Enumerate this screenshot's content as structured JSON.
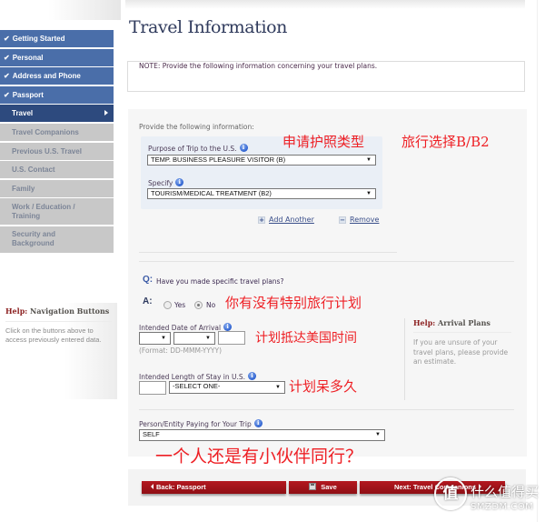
{
  "sidebar": {
    "items": [
      {
        "label": "Getting Started",
        "state": "done"
      },
      {
        "label": "Personal",
        "state": "done"
      },
      {
        "label": "Address and Phone",
        "state": "done"
      },
      {
        "label": "Passport",
        "state": "done"
      },
      {
        "label": "Travel",
        "state": "active"
      },
      {
        "label": "Travel Companions",
        "state": "pending"
      },
      {
        "label": "Previous U.S. Travel",
        "state": "pending"
      },
      {
        "label": "U.S. Contact",
        "state": "pending"
      },
      {
        "label": "Family",
        "state": "pending"
      },
      {
        "label": "Work / Education / Training",
        "state": "pending"
      },
      {
        "label": "Security and Background",
        "state": "pending"
      }
    ],
    "check_glyph": "✔",
    "help": {
      "label": "Help:",
      "title": "Navigation Buttons",
      "text": "Click on the buttons above to access previously entered data."
    }
  },
  "page": {
    "title": "Travel Information",
    "note": "NOTE: Provide the following information concerning your travel plans."
  },
  "form": {
    "intro": "Provide the following information:",
    "purpose": {
      "label": "Purpose of Trip to the U.S.",
      "value": "TEMP. BUSINESS PLEASURE VISITOR (B)"
    },
    "specify": {
      "label": "Specify",
      "value": "TOURISM/MEDICAL TREATMENT (B2)"
    },
    "add_another": "Add Another",
    "remove": "Remove",
    "question": {
      "q_marker": "Q:",
      "text": "Have you made specific travel plans?",
      "a_marker": "A:",
      "options": [
        "Yes",
        "No"
      ],
      "selected": "No"
    },
    "arrival": {
      "label": "Intended Date of Arrival",
      "day": "",
      "month": "",
      "year": "",
      "format_hint": "(Format: DD-MMM-YYYY)"
    },
    "stay": {
      "label": "Intended Length of Stay in U.S.",
      "number": "",
      "unit": "-SELECT ONE-"
    },
    "paying": {
      "label": "Person/Entity Paying for Your Trip",
      "value": "SELF"
    },
    "info_glyph": "i",
    "caret_glyph": "▼"
  },
  "help_arrival": {
    "label": "Help:",
    "title": "Arrival Plans",
    "text": "If you are unsure of your travel plans, please provide an estimate."
  },
  "annotations": {
    "visa_type": "申请护照类型",
    "choose_b2": "旅行选择B/B2",
    "travel_plans": "你有没有特别旅行计划",
    "arrival_time": "计划抵达美国时间",
    "stay_length": "计划呆多久",
    "companions": "一个人还是有小伙伴同行？"
  },
  "buttons": {
    "back": "Back: Passport",
    "save": "Save",
    "next": "Next: Travel Companions"
  },
  "watermark": {
    "glyph": "值",
    "text": "什么值得买",
    "sub": "SMZDM.COM"
  },
  "colors": {
    "nav_done": "#4a6ea9",
    "nav_active": "#2d4a7e",
    "nav_pending": "#c8c8c8",
    "button_red": "#a3141b",
    "annotation_red": "#ee1f24"
  }
}
